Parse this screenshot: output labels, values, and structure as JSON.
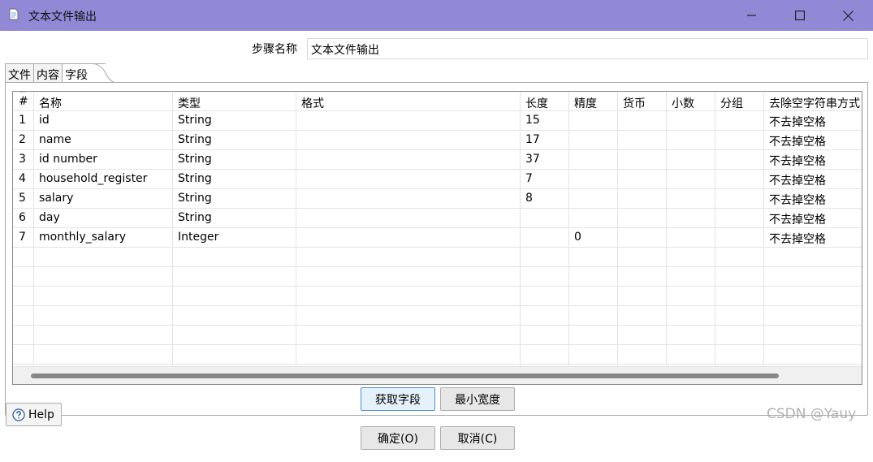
{
  "window": {
    "title": "文本文件输出",
    "minimize_icon": "minimize-icon",
    "maximize_icon": "maximize-icon",
    "close_icon": "close-icon"
  },
  "step": {
    "label": "步骤名称",
    "value": "文本文件输出"
  },
  "tabs": [
    {
      "label": "文件",
      "active": false
    },
    {
      "label": "内容",
      "active": false
    },
    {
      "label": "字段",
      "active": true
    }
  ],
  "table": {
    "columns": [
      "#",
      "名称",
      "类型",
      "格式",
      "长度",
      "精度",
      "货币",
      "小数",
      "分组",
      "去除空字符串方式"
    ],
    "rows": [
      {
        "n": "1",
        "name": "id",
        "type": "String",
        "format": "",
        "length": "15",
        "precision": "",
        "currency": "",
        "decimal": "",
        "group": "",
        "trim": "不去掉空格"
      },
      {
        "n": "2",
        "name": "name",
        "type": "String",
        "format": "",
        "length": "17",
        "precision": "",
        "currency": "",
        "decimal": "",
        "group": "",
        "trim": "不去掉空格"
      },
      {
        "n": "3",
        "name": "id number",
        "type": "String",
        "format": "",
        "length": "37",
        "precision": "",
        "currency": "",
        "decimal": "",
        "group": "",
        "trim": "不去掉空格"
      },
      {
        "n": "4",
        "name": "household_register",
        "type": "String",
        "format": "",
        "length": "7",
        "precision": "",
        "currency": "",
        "decimal": "",
        "group": "",
        "trim": "不去掉空格"
      },
      {
        "n": "5",
        "name": "salary",
        "type": "String",
        "format": "",
        "length": "8",
        "precision": "",
        "currency": "",
        "decimal": "",
        "group": "",
        "trim": "不去掉空格"
      },
      {
        "n": "6",
        "name": "day",
        "type": "String",
        "format": "",
        "length": "",
        "precision": "",
        "currency": "",
        "decimal": "",
        "group": "",
        "trim": "不去掉空格"
      },
      {
        "n": "7",
        "name": "monthly_salary",
        "type": "Integer",
        "format": "",
        "length": "",
        "precision": "0",
        "currency": "",
        "decimal": "",
        "group": "",
        "trim": "不去掉空格"
      }
    ],
    "empty_rows": 6
  },
  "buttons": {
    "get_fields": "获取字段",
    "min_width": "最小宽度",
    "ok": "确定(O)",
    "cancel": "取消(C)",
    "help": "Help"
  },
  "watermark": "CSDN @Yauy"
}
